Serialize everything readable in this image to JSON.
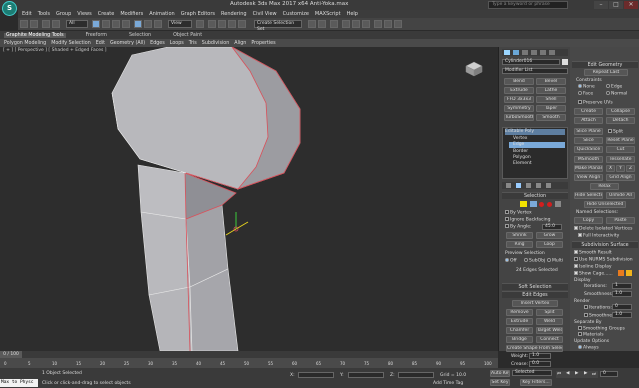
{
  "app": {
    "logo_letter": "S",
    "title": "Autodesk 3ds Max 2017 x64    Anti-Yoka.max",
    "search_placeholder": "Type a keyword or phrase",
    "win_buttons": [
      "–",
      "□",
      "✕"
    ]
  },
  "menu": [
    "Edit",
    "Tools",
    "Group",
    "Views",
    "Create",
    "Modifiers",
    "Animation",
    "Graph Editors",
    "Rendering",
    "Civil View",
    "Customize",
    "MAXScript",
    "Help"
  ],
  "toolbar": {
    "selection_filter": "All",
    "view_dropdown": "View",
    "selection_set": "Create Selection Set"
  },
  "ribbon": {
    "tabs": [
      "Graphite Modeling Tools",
      "Freeform",
      "Selection",
      "Object Paint"
    ],
    "active_tab": "Graphite Modeling Tools",
    "row": [
      "Polygon Modeling",
      "Modify Selection",
      "Edit",
      "Geometry (All)",
      "Edges",
      "Loops",
      "Tris",
      "Subdivision",
      "Align",
      "Properties"
    ]
  },
  "viewport": {
    "label": "[ + ] [ Perspective ] [ Shaded + Edged Faces ]"
  },
  "command_panel": {
    "object_name": "Cylinder016",
    "modifier_list": "Modifier List",
    "modifier_buttons": [
      "Bend",
      "Bevel",
      "Extrude",
      "Lathe",
      "FFD 3x3x3",
      "Shell",
      "Symmetry",
      "Taper",
      "TurboSmooth",
      "Smooth"
    ],
    "stack_title": "Editable Poly",
    "stack_items": [
      "Vertex",
      "Edge",
      "Border",
      "Polygon",
      "Element"
    ],
    "stack_selected": "Edge",
    "selection": {
      "title": "Selection",
      "by_vertex": "By Vertex",
      "ignore_backfacing": "Ignore Backfacing",
      "by_angle": "By Angle:",
      "by_angle_value": "45.0",
      "shrink": "Shrink",
      "grow": "Grow",
      "ring": "Ring",
      "loop": "Loop",
      "preview_selection": "Preview Selection",
      "preview_options": [
        "Off",
        "SubObj",
        "Multi"
      ],
      "status": "24 Edges Selected"
    },
    "soft_selection": "Soft Selection",
    "edit_edges": {
      "title": "Edit Edges",
      "insert_vertex": "Insert Vertex",
      "remove": "Remove",
      "split": "Split",
      "extrude": "Extrude",
      "weld": "Weld",
      "chamfer": "Chamfer",
      "target_weld": "Target Weld",
      "bridge": "Bridge",
      "connect": "Connect",
      "create_shape": "Create Shape From Selection",
      "weight_label": "Weight:",
      "weight_value": "1.0",
      "crease_label": "Crease:",
      "crease_value": "0.0"
    }
  },
  "edit_geometry": {
    "title": "Edit Geometry",
    "repeat_last": "Repeat Last",
    "constraints_label": "Constraints",
    "constraints": [
      "None",
      "Edge",
      "Face",
      "Normal"
    ],
    "preserve_uvs": "Preserve UVs",
    "create": "Create",
    "collapse": "Collapse",
    "attach": "Attach",
    "detach": "Detach",
    "slice_plane": "Slice Plane",
    "split": "Split",
    "slice": "Slice",
    "reset_plane": "Reset Plane",
    "quickslice": "QuickSlice",
    "cut": "Cut",
    "msmooth": "MSmooth",
    "tessellate": "Tessellate",
    "make_planar": "Make Planar",
    "xyz": [
      "X",
      "Y",
      "Z"
    ],
    "view_align": "View Align",
    "grid_align": "Grid Align",
    "relax": "Relax",
    "hide_selected": "Hide Selected",
    "unhide_all": "Unhide All",
    "hide_unselected": "Hide Unselected",
    "named_selections": "Named Selections:",
    "copy": "Copy",
    "paste": "Paste",
    "delete_isolated": "Delete Isolated Vertices",
    "full_interactivity": "Full Interactivity"
  },
  "subdivision": {
    "title": "Subdivision Surface",
    "smooth_result": "Smooth Result",
    "use_nurms": "Use NURMS Subdivision",
    "isoline_display": "Isoline Display",
    "show_cage": "Show Cage......",
    "display_label": "Display",
    "iterations_label": "Iterations:",
    "iterations_value": "1",
    "smoothness_label": "Smoothness:",
    "smoothness_value": "1.0",
    "render_label": "Render",
    "render_iterations_value": "0",
    "render_smoothness_value": "1.0",
    "separate_by": "Separate By",
    "smoothing_groups": "Smoothing Groups",
    "materials": "Materials",
    "update_options": "Update Options",
    "always": "Always",
    "when_rendering": "When Rendering",
    "manually": "Manually",
    "cage_colors": [
      "#e87b1e",
      "#f0b41c"
    ]
  },
  "timeline": {
    "frame": "0 / 100",
    "ticks": [
      "0",
      "5",
      "10",
      "15",
      "20",
      "25",
      "30",
      "35",
      "40",
      "45",
      "50",
      "55",
      "60",
      "65",
      "70",
      "75",
      "80",
      "85",
      "90",
      "95",
      "100"
    ]
  },
  "status": {
    "maxscript": "Max to Physc",
    "selected": "1 Object Selected",
    "prompt": "Click or click-and-drag to select objects",
    "x_label": "X:",
    "y_label": "Y:",
    "z_label": "Z:",
    "grid": "Grid = 10.0",
    "add_time_tag": "Add Time Tag",
    "auto_key": "Auto Key",
    "selected_dropdown": "Selected",
    "set_key": "Set Key",
    "key_filters": "Key Filters...",
    "frame_value": "0"
  },
  "colors": {
    "accent_blue": "#7aa9d8",
    "edge_red": "#d8505a",
    "gizmo_yellow": "#e6d21e",
    "gizmo_green": "#3ccb3c",
    "subobj_yellow": "#f2e100",
    "subobj_red": "#d21e1e"
  }
}
